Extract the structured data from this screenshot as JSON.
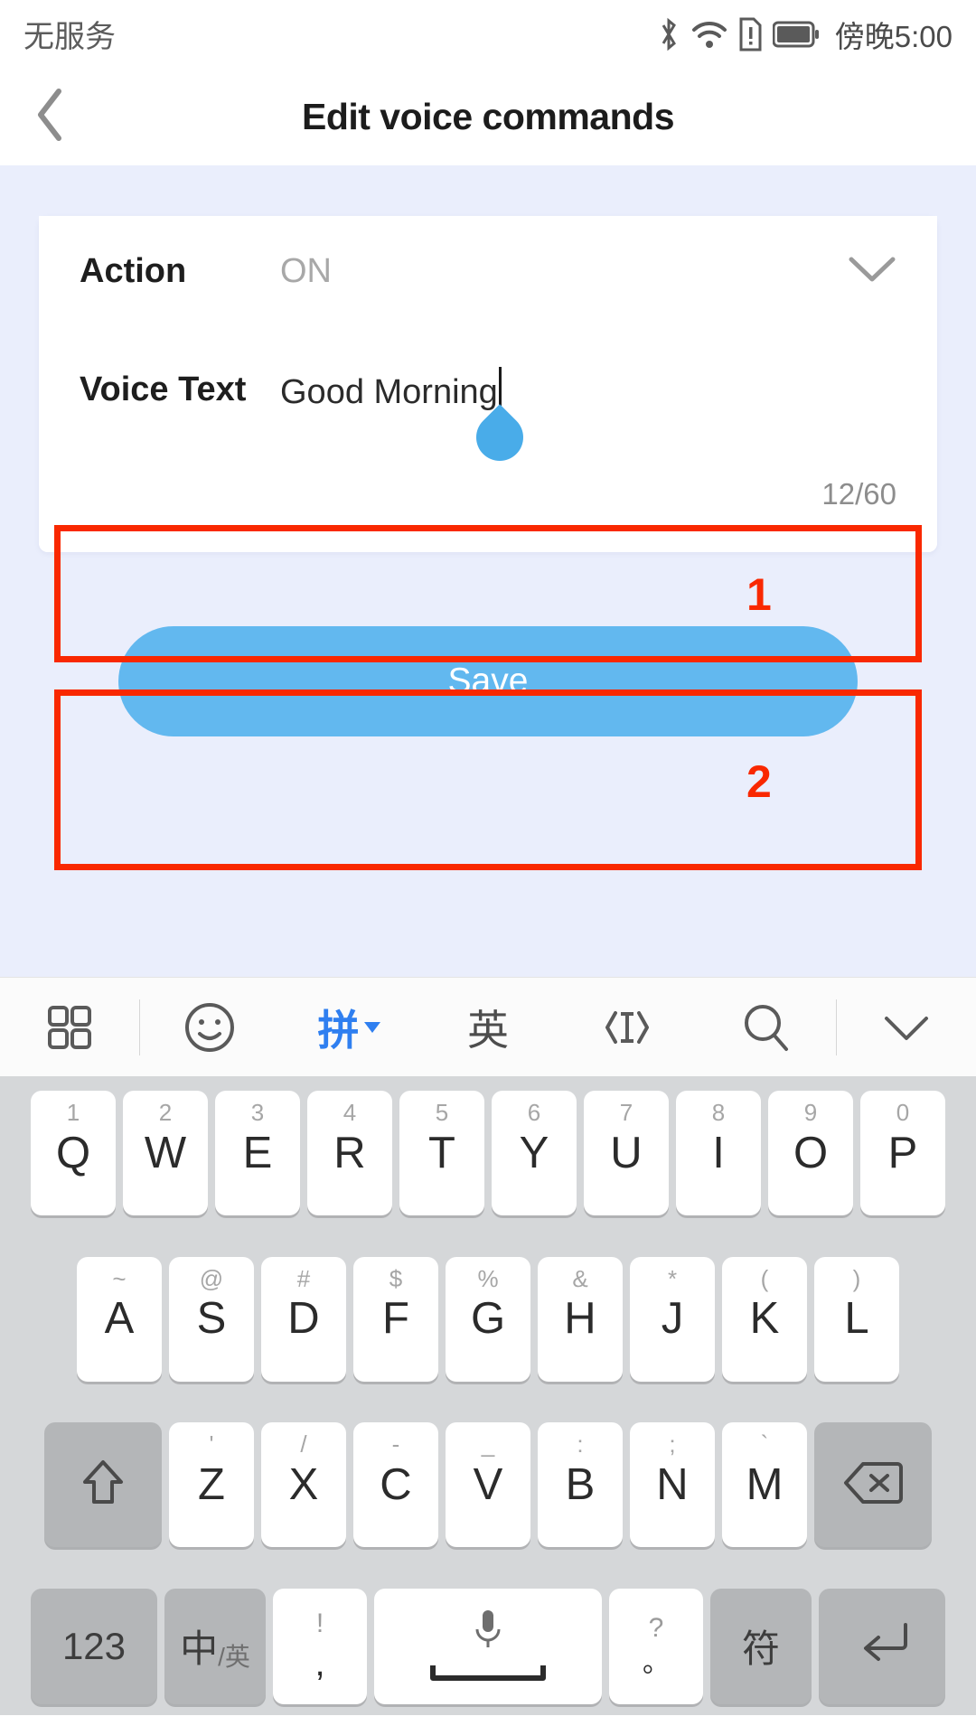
{
  "statusbar": {
    "carrier": "无服务",
    "time": "傍晚5:00",
    "icons": [
      "bluetooth-icon",
      "wifi-icon",
      "sim-warning-icon",
      "battery-icon"
    ]
  },
  "navbar": {
    "title": "Edit voice commands",
    "back_icon": "chevron-left-icon"
  },
  "form": {
    "action": {
      "label": "Action",
      "value": "ON",
      "chevron_icon": "chevron-down-icon"
    },
    "voice_text": {
      "label": "Voice Text",
      "value": "Good Morning",
      "placeholder": "Voice Text"
    },
    "counter": "12/60",
    "save_label": "Save"
  },
  "annotations": [
    {
      "number": "1",
      "target": "voice-text-row"
    },
    {
      "number": "2",
      "target": "save-button"
    }
  ],
  "colors": {
    "accent_blue": "#62b8ef",
    "annotation_red": "#f92800",
    "content_bg": "#eaeefc",
    "keyboard_bg": "#d5d7d9",
    "toolbar_active": "#2f7ff0"
  },
  "keyboard": {
    "toolbar": [
      {
        "name": "grid-icon",
        "label": ""
      },
      {
        "name": "emoji-icon",
        "label": ""
      },
      {
        "name": "pinyin-mode",
        "label": "拼"
      },
      {
        "name": "english-mode",
        "label": "英"
      },
      {
        "name": "cursor-move-icon",
        "label": ""
      },
      {
        "name": "search-icon",
        "label": ""
      },
      {
        "name": "collapse-keyboard-icon",
        "label": ""
      }
    ],
    "row1": [
      {
        "key": "Q",
        "hint": "1"
      },
      {
        "key": "W",
        "hint": "2"
      },
      {
        "key": "E",
        "hint": "3"
      },
      {
        "key": "R",
        "hint": "4"
      },
      {
        "key": "T",
        "hint": "5"
      },
      {
        "key": "Y",
        "hint": "6"
      },
      {
        "key": "U",
        "hint": "7"
      },
      {
        "key": "I",
        "hint": "8"
      },
      {
        "key": "O",
        "hint": "9"
      },
      {
        "key": "P",
        "hint": "0"
      }
    ],
    "row2": [
      {
        "key": "A",
        "hint": "~"
      },
      {
        "key": "S",
        "hint": "@"
      },
      {
        "key": "D",
        "hint": "#"
      },
      {
        "key": "F",
        "hint": "$"
      },
      {
        "key": "G",
        "hint": "%"
      },
      {
        "key": "H",
        "hint": "&"
      },
      {
        "key": "J",
        "hint": "*"
      },
      {
        "key": "K",
        "hint": "("
      },
      {
        "key": "L",
        "hint": ")"
      }
    ],
    "row3": [
      {
        "key": "Z",
        "hint": "'"
      },
      {
        "key": "X",
        "hint": "/"
      },
      {
        "key": "C",
        "hint": "-"
      },
      {
        "key": "V",
        "hint": "_"
      },
      {
        "key": "B",
        "hint": ":"
      },
      {
        "key": "N",
        "hint": ";"
      },
      {
        "key": "M",
        "hint": "`"
      }
    ],
    "shift_icon": "shift-icon",
    "backspace_icon": "backspace-icon",
    "row4": {
      "numeric": "123",
      "lang_main": "中",
      "lang_sub": "/英",
      "comma_top": "!",
      "comma_bottom": ",",
      "space_icon": "microphone-icon",
      "period_top": "?",
      "period_bottom": "。",
      "symbols": "符",
      "enter_icon": "enter-icon"
    }
  }
}
